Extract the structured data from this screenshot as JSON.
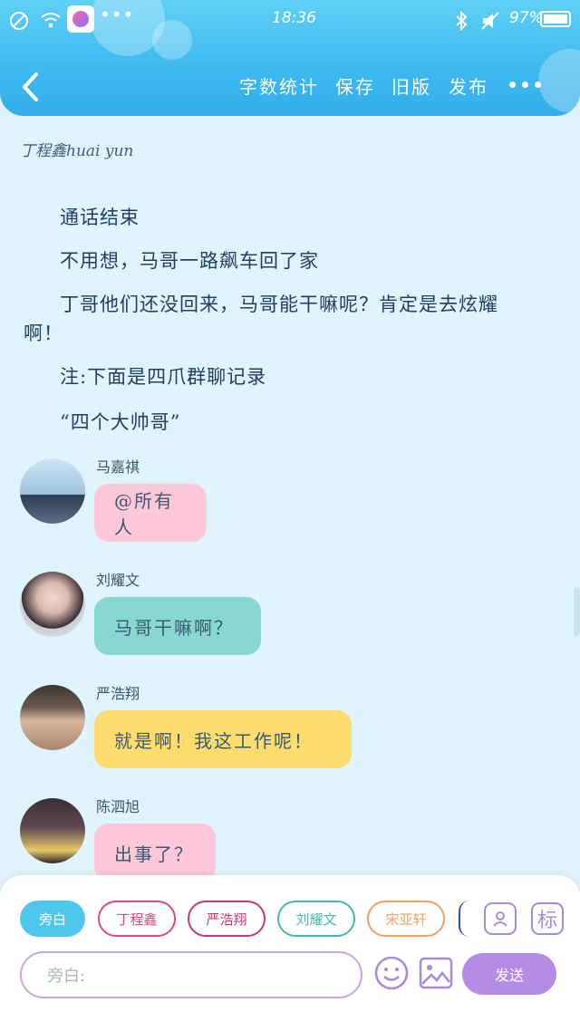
{
  "status_bar": {
    "time": "18:36",
    "battery": "97%"
  },
  "nav": {
    "word_count": "字数统计",
    "save": "保存",
    "old_version": "旧版",
    "publish": "发布"
  },
  "author_line": "丁程鑫huai yun",
  "paragraphs": [
    "通话结束",
    "不用想，马哥一路飙车回了家",
    "丁哥他们还没回来，马哥能干嘛呢？肯定是去炫耀",
    "啊！",
    "注:下面是四爪群聊记录",
    "“四个大帅哥”"
  ],
  "chat": [
    {
      "name": "马嘉祺",
      "message": "@所有人",
      "bubble_color": "#ffc8d8"
    },
    {
      "name": "刘耀文",
      "message": "马哥干嘛啊？",
      "bubble_color": "#87d8d0"
    },
    {
      "name": "严浩翔",
      "message": "就是啊！我这工作呢！",
      "bubble_color": "#fedd6e"
    },
    {
      "name": "陈泗旭",
      "message": "出事了？",
      "bubble_color": "#ffc8d8"
    }
  ],
  "role_chips": [
    {
      "label": "旁白",
      "color": "#4ec7ef",
      "filled": true
    },
    {
      "label": "丁程鑫",
      "color": "#e0487f",
      "filled": false
    },
    {
      "label": "严浩翔",
      "color": "#c43a73",
      "filled": false
    },
    {
      "label": "刘耀文",
      "color": "#46b6b5",
      "filled": false
    },
    {
      "label": "宋亚轩",
      "color": "#f0a164",
      "filled": false
    }
  ],
  "tool_buttons": {
    "tag_label": "标"
  },
  "input": {
    "placeholder": "旁白:"
  },
  "send_label": "发送",
  "icons": [
    "no-disturb-icon",
    "wifi-icon",
    "app-icon",
    "bluetooth-icon",
    "mute-icon",
    "battery-icon",
    "back-icon",
    "more-icon",
    "person-card-icon",
    "emoji-icon",
    "image-icon"
  ]
}
